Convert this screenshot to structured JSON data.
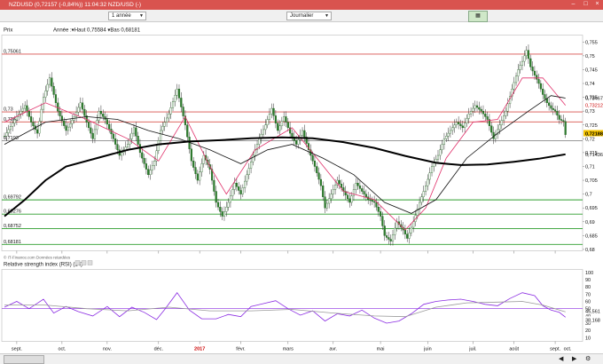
{
  "window": {
    "title": "NZDUSD (0,72157 (-0,84%)) 11:04:32 NZD/USD (-)"
  },
  "toolbar": {
    "period": "1 année",
    "interval": "Journalier"
  },
  "price_panel": {
    "label": "Prix",
    "info": "Année :▾Haut 0,75584 ▾Bas 0,68181",
    "source": "© IT-Finance.com Données retardées"
  },
  "rsi_panel": {
    "label": "Relative strength index (RSI) (14)"
  },
  "colors": {
    "titlebar": "#d9534f",
    "candle_up": "#ffffff",
    "candle_down": "#2e7d2e",
    "ma_fast": "#e0306a",
    "ma_mid": "#111111",
    "ma_slow": "#000000",
    "resistance": "#d9534f",
    "support": "#2e9e2e",
    "rsi": "#8a2be2",
    "rsi_signal": "#999999"
  },
  "chart_data": [
    {
      "type": "candlestick",
      "title": "NZD/USD",
      "x_tick_labels": [
        "sept.",
        "oct.",
        "nov.",
        "déc.",
        "2017",
        "févr.",
        "mars",
        "avr.",
        "mai",
        "juin",
        "juil.",
        "août",
        "sept.",
        "oct."
      ],
      "y_tick_labels": [
        "0,755",
        "0,75",
        "0,745",
        "0,74",
        "0,735",
        "0,73",
        "0,725",
        "0,72",
        "0,715",
        "0,71",
        "0,705",
        "0,7",
        "0,695",
        "0,69",
        "0,685",
        "0,68"
      ],
      "ylim": [
        0.6795,
        0.7575
      ],
      "level_labels": [
        {
          "text": "0,75061",
          "value": 0.75061,
          "kind": "resistance"
        },
        {
          "text": "0,73",
          "value": 0.7297,
          "kind": "resistance"
        },
        {
          "text": "0,7261",
          "value": 0.7261,
          "kind": "resistance"
        },
        {
          "text": "0,7193",
          "value": 0.7193,
          "kind": "neutral"
        },
        {
          "text": "0,69792",
          "value": 0.69792,
          "kind": "support"
        },
        {
          "text": "0,69276",
          "value": 0.69276,
          "kind": "support"
        },
        {
          "text": "0,68752",
          "value": 0.68752,
          "kind": "support"
        },
        {
          "text": "0,68181",
          "value": 0.68181,
          "kind": "support"
        }
      ],
      "right_labels": [
        {
          "text": "0,73467",
          "value": 0.73467
        },
        {
          "text": "0,73212",
          "value": 0.73212
        },
        {
          "text": "0,72188",
          "value": 0.72188,
          "highlight": true
        },
        {
          "text": "0,71436",
          "value": 0.71436
        }
      ],
      "close_path": [
        [
          0,
          0.721
        ],
        [
          6,
          0.728
        ],
        [
          10,
          0.732
        ],
        [
          13,
          0.726
        ],
        [
          16,
          0.722
        ],
        [
          19,
          0.735
        ],
        [
          22,
          0.742
        ],
        [
          26,
          0.73
        ],
        [
          30,
          0.723
        ],
        [
          34,
          0.728
        ],
        [
          37,
          0.733
        ],
        [
          40,
          0.726
        ],
        [
          43,
          0.72
        ],
        [
          46,
          0.73
        ],
        [
          49,
          0.727
        ],
        [
          53,
          0.72
        ],
        [
          56,
          0.714
        ],
        [
          60,
          0.718
        ],
        [
          63,
          0.724
        ],
        [
          66,
          0.715
        ],
        [
          70,
          0.707
        ],
        [
          73,
          0.712
        ],
        [
          76,
          0.723
        ],
        [
          80,
          0.729
        ],
        [
          84,
          0.738
        ],
        [
          88,
          0.725
        ],
        [
          91,
          0.712
        ],
        [
          94,
          0.705
        ],
        [
          97,
          0.714
        ],
        [
          100,
          0.709
        ],
        [
          103,
          0.697
        ],
        [
          106,
          0.692
        ],
        [
          109,
          0.697
        ],
        [
          112,
          0.704
        ],
        [
          115,
          0.7
        ],
        [
          118,
          0.707
        ],
        [
          121,
          0.714
        ],
        [
          124,
          0.72
        ],
        [
          127,
          0.725
        ],
        [
          130,
          0.731
        ],
        [
          133,
          0.723
        ],
        [
          136,
          0.728
        ],
        [
          139,
          0.722
        ],
        [
          142,
          0.718
        ],
        [
          145,
          0.723
        ],
        [
          148,
          0.716
        ],
        [
          151,
          0.71
        ],
        [
          154,
          0.703
        ],
        [
          156,
          0.695
        ],
        [
          159,
          0.7
        ],
        [
          162,
          0.705
        ],
        [
          165,
          0.701
        ],
        [
          168,
          0.697
        ],
        [
          171,
          0.704
        ],
        [
          174,
          0.701
        ],
        [
          177,
          0.698
        ],
        [
          180,
          0.697
        ],
        [
          183,
          0.692
        ],
        [
          185,
          0.685
        ],
        [
          188,
          0.683
        ],
        [
          191,
          0.69
        ],
        [
          194,
          0.687
        ],
        [
          196,
          0.684
        ],
        [
          199,
          0.69
        ],
        [
          202,
          0.697
        ],
        [
          205,
          0.703
        ],
        [
          208,
          0.71
        ],
        [
          211,
          0.714
        ],
        [
          214,
          0.72
        ],
        [
          217,
          0.723
        ],
        [
          220,
          0.726
        ],
        [
          223,
          0.724
        ],
        [
          226,
          0.729
        ],
        [
          229,
          0.732
        ],
        [
          232,
          0.73
        ],
        [
          235,
          0.727
        ],
        [
          238,
          0.72
        ],
        [
          241,
          0.725
        ],
        [
          244,
          0.73
        ],
        [
          247,
          0.738
        ],
        [
          250,
          0.745
        ],
        [
          252,
          0.748
        ],
        [
          254,
          0.752
        ],
        [
          256,
          0.746
        ],
        [
          258,
          0.743
        ],
        [
          260,
          0.74
        ],
        [
          262,
          0.736
        ],
        [
          264,
          0.733
        ],
        [
          266,
          0.731
        ],
        [
          268,
          0.73
        ],
        [
          270,
          0.727
        ],
        [
          272,
          0.7263
        ],
        [
          273,
          0.7215
        ]
      ],
      "series": [
        {
          "kind": "ma_fast",
          "values": [
            [
              0,
              0.726
            ],
            [
              20,
              0.733
            ],
            [
              40,
              0.727
            ],
            [
              60,
              0.72
            ],
            [
              75,
              0.712
            ],
            [
              88,
              0.728
            ],
            [
              100,
              0.71
            ],
            [
              108,
              0.7
            ],
            [
              122,
              0.716
            ],
            [
              140,
              0.724
            ],
            [
              152,
              0.713
            ],
            [
              165,
              0.701
            ],
            [
              180,
              0.698
            ],
            [
              195,
              0.687
            ],
            [
              205,
              0.695
            ],
            [
              215,
              0.713
            ],
            [
              228,
              0.726
            ],
            [
              240,
              0.727
            ],
            [
              252,
              0.742
            ],
            [
              262,
              0.742
            ],
            [
              273,
              0.7321
            ]
          ]
        },
        {
          "kind": "ma_mid",
          "values": [
            [
              0,
              0.718
            ],
            [
              20,
              0.726
            ],
            [
              40,
              0.728
            ],
            [
              55,
              0.727
            ],
            [
              70,
              0.723
            ],
            [
              85,
              0.72
            ],
            [
              100,
              0.716
            ],
            [
              115,
              0.711
            ],
            [
              128,
              0.716
            ],
            [
              140,
              0.718
            ],
            [
              155,
              0.713
            ],
            [
              170,
              0.707
            ],
            [
              185,
              0.697
            ],
            [
              198,
              0.693
            ],
            [
              210,
              0.698
            ],
            [
              225,
              0.713
            ],
            [
              240,
              0.722
            ],
            [
              255,
              0.73
            ],
            [
              266,
              0.7356
            ],
            [
              273,
              0.7347
            ]
          ]
        },
        {
          "kind": "ma_slow",
          "values": [
            [
              0,
              0.692
            ],
            [
              10,
              0.698
            ],
            [
              20,
              0.705
            ],
            [
              30,
              0.71
            ],
            [
              45,
              0.713
            ],
            [
              60,
              0.716
            ],
            [
              75,
              0.718
            ],
            [
              90,
              0.719
            ],
            [
              105,
              0.7195
            ],
            [
              120,
              0.7202
            ],
            [
              135,
              0.7205
            ],
            [
              150,
              0.7202
            ],
            [
              165,
              0.7188
            ],
            [
              180,
              0.7167
            ],
            [
              195,
              0.7138
            ],
            [
              210,
              0.7113
            ],
            [
              222,
              0.7105
            ],
            [
              235,
              0.7107
            ],
            [
              248,
              0.7117
            ],
            [
              260,
              0.7128
            ],
            [
              273,
              0.7144
            ]
          ]
        }
      ]
    },
    {
      "type": "line",
      "title": "Relative strength index (RSI) (14)",
      "y_tick_labels": [
        "100",
        "90",
        "80",
        "70",
        "60",
        "50",
        "40",
        "30",
        "20",
        "10"
      ],
      "ylim": [
        5,
        104
      ],
      "right_labels": [
        {
          "text": "45,561",
          "value": 45.561
        },
        {
          "text": "38,168",
          "value": 38.168,
          "highlight": true
        }
      ],
      "series": [
        {
          "kind": "rsi",
          "values": [
            [
              0,
              52
            ],
            [
              6,
              60
            ],
            [
              12,
              50
            ],
            [
              19,
              63
            ],
            [
              24,
              44
            ],
            [
              30,
              53
            ],
            [
              36,
              46
            ],
            [
              43,
              40
            ],
            [
              50,
              53
            ],
            [
              56,
              39
            ],
            [
              62,
              52
            ],
            [
              68,
              45
            ],
            [
              74,
              35
            ],
            [
              78,
              49
            ],
            [
              84,
              72
            ],
            [
              90,
              48
            ],
            [
              96,
              36
            ],
            [
              103,
              36
            ],
            [
              109,
              42
            ],
            [
              115,
              39
            ],
            [
              120,
              53
            ],
            [
              126,
              57
            ],
            [
              132,
              61
            ],
            [
              138,
              50
            ],
            [
              144,
              41
            ],
            [
              150,
              47
            ],
            [
              156,
              33
            ],
            [
              162,
              43
            ],
            [
              168,
              40
            ],
            [
              174,
              48
            ],
            [
              180,
              37
            ],
            [
              186,
              30
            ],
            [
              192,
              33
            ],
            [
              198,
              43
            ],
            [
              204,
              56
            ],
            [
              210,
              60
            ],
            [
              216,
              62
            ],
            [
              222,
              63
            ],
            [
              228,
              60
            ],
            [
              234,
              56
            ],
            [
              240,
              54
            ],
            [
              246,
              64
            ],
            [
              252,
              72
            ],
            [
              258,
              68
            ],
            [
              262,
              54
            ],
            [
              266,
              48
            ],
            [
              270,
              45
            ],
            [
              273,
              38.2
            ]
          ]
        },
        {
          "kind": "rsi_signal",
          "values": [
            [
              0,
              55
            ],
            [
              20,
              55
            ],
            [
              40,
              50
            ],
            [
              60,
              47
            ],
            [
              80,
              52
            ],
            [
              100,
              47
            ],
            [
              120,
              47
            ],
            [
              140,
              49
            ],
            [
              160,
              44
            ],
            [
              180,
              40
            ],
            [
              195,
              39
            ],
            [
              210,
              52
            ],
            [
              225,
              58
            ],
            [
              240,
              59
            ],
            [
              252,
              60
            ],
            [
              262,
              55
            ],
            [
              273,
              45.6
            ]
          ]
        }
      ]
    }
  ]
}
